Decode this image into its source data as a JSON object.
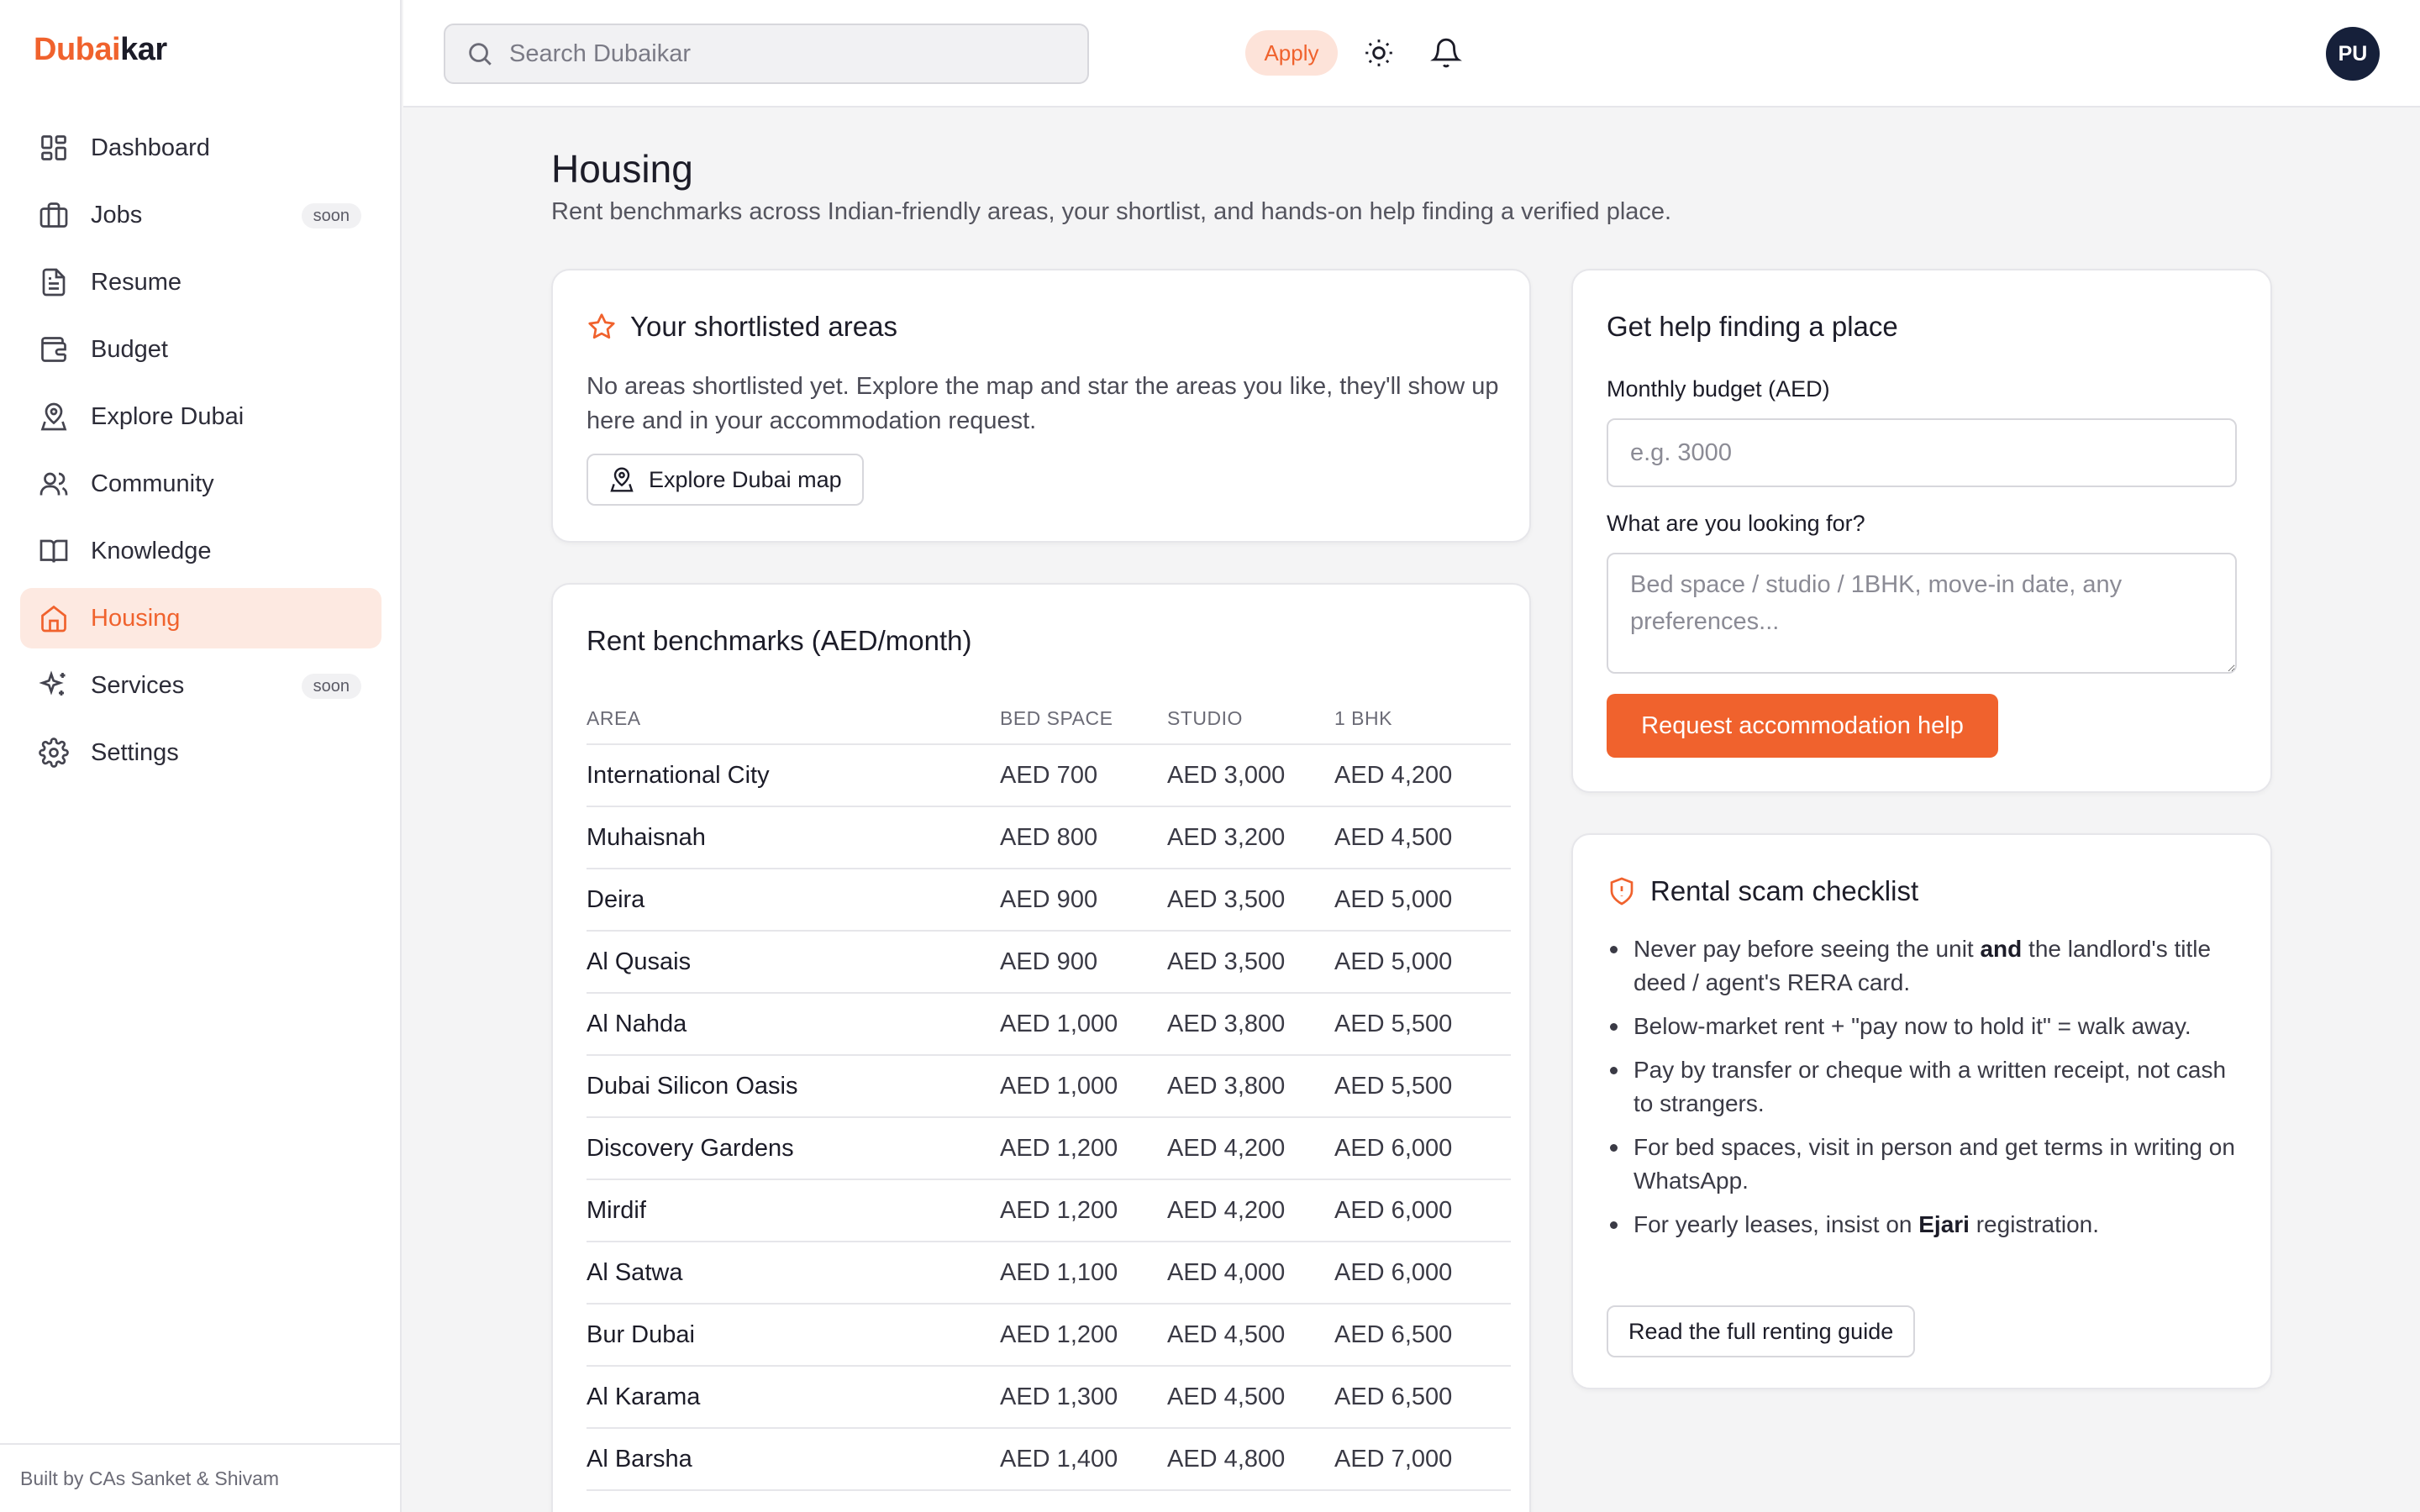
{
  "app": {
    "logo_part1": "Dubai",
    "logo_part2": "kar",
    "footer": "Built by CAs Sanket & Shivam"
  },
  "sidebar": {
    "items": [
      {
        "label": "Dashboard",
        "icon": "dashboard-icon"
      },
      {
        "label": "Jobs",
        "icon": "briefcase-icon",
        "badge": "soon"
      },
      {
        "label": "Resume",
        "icon": "document-icon"
      },
      {
        "label": "Budget",
        "icon": "wallet-icon"
      },
      {
        "label": "Explore Dubai",
        "icon": "map-pin-icon"
      },
      {
        "label": "Community",
        "icon": "users-icon"
      },
      {
        "label": "Knowledge",
        "icon": "book-icon"
      },
      {
        "label": "Housing",
        "icon": "home-icon",
        "active": true
      },
      {
        "label": "Services",
        "icon": "sparkles-icon",
        "badge": "soon"
      },
      {
        "label": "Settings",
        "icon": "gear-icon"
      }
    ]
  },
  "header": {
    "search_placeholder": "Search Dubaikar",
    "apply_label": "Apply",
    "avatar_initials": "PU"
  },
  "page": {
    "title": "Housing",
    "subtitle": "Rent benchmarks across Indian-friendly areas, your shortlist, and hands-on help finding a verified place."
  },
  "shortlist": {
    "title": "Your shortlisted areas",
    "text": "No areas shortlisted yet. Explore the map and star the areas you like, they'll show up here and in your accommodation request.",
    "button": "Explore Dubai map"
  },
  "rent": {
    "title": "Rent benchmarks (AED/month)",
    "columns": [
      "AREA",
      "BED SPACE",
      "STUDIO",
      "1 BHK"
    ],
    "rows": [
      {
        "area": "International City",
        "bed": "AED 700",
        "studio": "AED 3,000",
        "bhk": "AED 4,200"
      },
      {
        "area": "Muhaisnah",
        "bed": "AED 800",
        "studio": "AED 3,200",
        "bhk": "AED 4,500"
      },
      {
        "area": "Deira",
        "bed": "AED 900",
        "studio": "AED 3,500",
        "bhk": "AED 5,000"
      },
      {
        "area": "Al Qusais",
        "bed": "AED 900",
        "studio": "AED 3,500",
        "bhk": "AED 5,000"
      },
      {
        "area": "Al Nahda",
        "bed": "AED 1,000",
        "studio": "AED 3,800",
        "bhk": "AED 5,500"
      },
      {
        "area": "Dubai Silicon Oasis",
        "bed": "AED 1,000",
        "studio": "AED 3,800",
        "bhk": "AED 5,500"
      },
      {
        "area": "Discovery Gardens",
        "bed": "AED 1,200",
        "studio": "AED 4,200",
        "bhk": "AED 6,000"
      },
      {
        "area": "Mirdif",
        "bed": "AED 1,200",
        "studio": "AED 4,200",
        "bhk": "AED 6,000"
      },
      {
        "area": "Al Satwa",
        "bed": "AED 1,100",
        "studio": "AED 4,000",
        "bhk": "AED 6,000"
      },
      {
        "area": "Bur Dubai",
        "bed": "AED 1,200",
        "studio": "AED 4,500",
        "bhk": "AED 6,500"
      },
      {
        "area": "Al Karama",
        "bed": "AED 1,300",
        "studio": "AED 4,500",
        "bhk": "AED 6,500"
      },
      {
        "area": "Al Barsha",
        "bed": "AED 1,400",
        "studio": "AED 4,800",
        "bhk": "AED 7,000"
      }
    ]
  },
  "help": {
    "title": "Get help finding a place",
    "budget_label": "Monthly budget (AED)",
    "budget_placeholder": "e.g. 3000",
    "looking_label": "What are you looking for?",
    "looking_placeholder": "Bed space / studio / 1BHK, move-in date, any preferences...",
    "submit": "Request accommodation help"
  },
  "scam": {
    "title": "Rental scam checklist",
    "items": [
      {
        "pre": "Never pay before seeing the unit ",
        "bold": "and",
        "post": " the landlord's title deed / agent's RERA card."
      },
      {
        "pre": "Below-market rent + \"pay now to hold it\" = walk away.",
        "bold": "",
        "post": ""
      },
      {
        "pre": "Pay by transfer or cheque with a written receipt, not cash to strangers.",
        "bold": "",
        "post": ""
      },
      {
        "pre": "For bed spaces, visit in person and get terms in writing on WhatsApp.",
        "bold": "",
        "post": ""
      },
      {
        "pre": "For yearly leases, insist on ",
        "bold": "Ejari",
        "post": " registration."
      }
    ],
    "button": "Read the full renting guide"
  },
  "colors": {
    "accent": "#f0622d",
    "accent_soft": "#fde9e1",
    "avatar_bg": "#16203a"
  }
}
